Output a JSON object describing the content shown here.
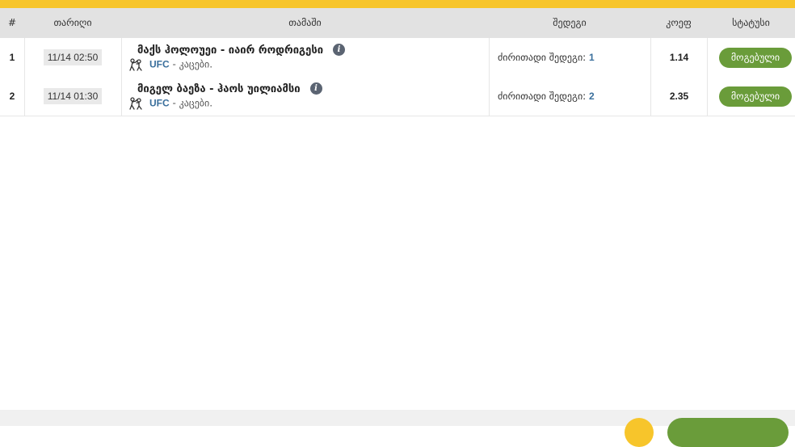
{
  "table": {
    "headers": {
      "num": "#",
      "date": "თარიღი",
      "game": "თამაში",
      "result": "შედეგი",
      "odd": "კოეფ",
      "status": "სტატუსი"
    },
    "rows": [
      {
        "num": "1",
        "date": "11/14 02:50",
        "game": "მაქს ჰოლოუეი - იაირ როდრიგესი",
        "league": "UFC",
        "league_sub": " - კაცები.",
        "result_label": "ძირითადი შედეგი: ",
        "result_pick": "1",
        "odd": "1.14",
        "status": "მოგებული"
      },
      {
        "num": "2",
        "date": "11/14 01:30",
        "game": "მიგელ ბაეზა - ჰაოს უილიამსი",
        "league": "UFC",
        "league_sub": " - კაცები.",
        "result_label": "ძირითადი შედეგი: ",
        "result_pick": "2",
        "odd": "2.35",
        "status": "მოგებული"
      }
    ]
  },
  "icons": {
    "info": "info-icon",
    "sport": "mma-fighter-icon"
  },
  "colors": {
    "accent_yellow": "#f7c52b",
    "status_green": "#6a9c3a",
    "league_blue": "#3a6f9c",
    "header_bg": "#e2e2e2"
  }
}
